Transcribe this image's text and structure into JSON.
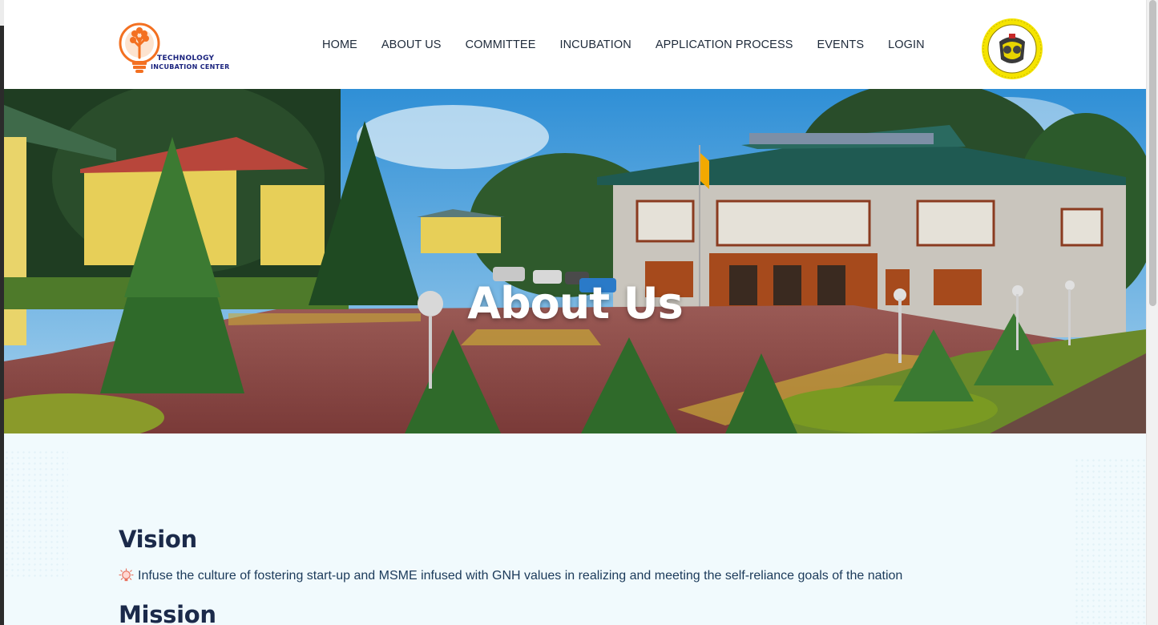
{
  "header": {
    "logo_left": {
      "line1": "TECHNOLOGY",
      "line2": "INCUBATION CENTER",
      "icon": "lightbulb-tree-logo-icon"
    },
    "nav": [
      {
        "label": "HOME"
      },
      {
        "label": "ABOUT US"
      },
      {
        "label": "COMMITTEE"
      },
      {
        "label": "INCUBATION"
      },
      {
        "label": "APPLICATION PROCESS"
      },
      {
        "label": "EVENTS"
      },
      {
        "label": "LOGIN"
      }
    ],
    "logo_right": {
      "icon": "college-seal-logo-icon"
    }
  },
  "hero": {
    "title": "About Us"
  },
  "main": {
    "vision": {
      "heading": "Vision",
      "icon": "lightbulb-icon",
      "text": "Infuse the culture of fostering start-up and MSME infused with GNH values in realizing and meeting the self-reliance goals of the nation"
    },
    "mission": {
      "heading": "Mission"
    }
  },
  "colors": {
    "nav_text": "#1e2a3a",
    "heading": "#1b2a4a",
    "content_bg": "#f1fafd",
    "logo_orange": "#f37021",
    "logo_blue": "#1a237e",
    "seal_yellow": "#f5e400"
  }
}
